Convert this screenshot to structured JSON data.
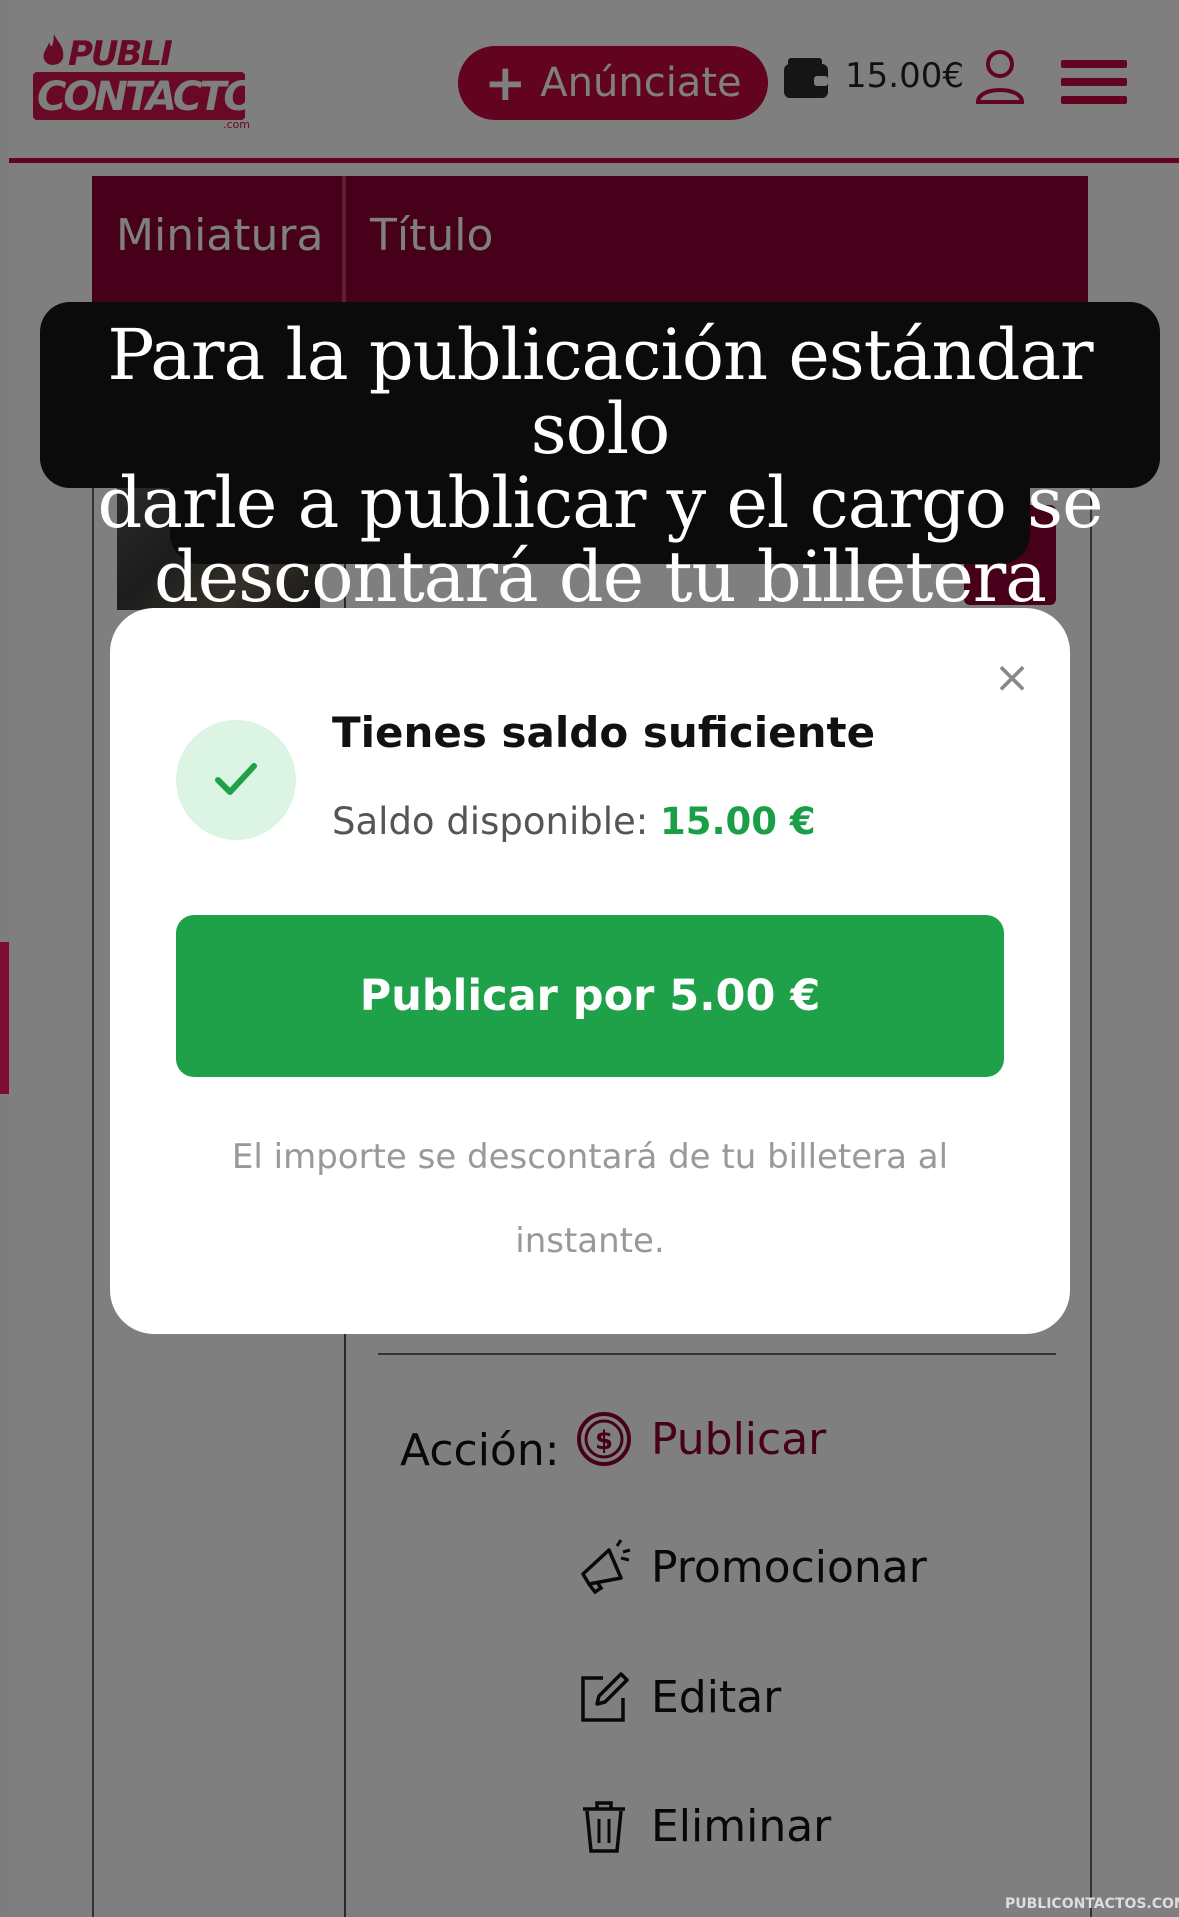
{
  "header": {
    "logo_top": "PUBLI",
    "logo_bottom": "CONTACTOS",
    "logo_suffix": ".com",
    "cta_label": "Anúnciate",
    "balance": "15.00€"
  },
  "table": {
    "col_thumbnail": "Miniatura",
    "col_title": "Título"
  },
  "actions": {
    "label": "Acción:",
    "publish": "Publicar",
    "promote": "Promocionar",
    "edit": "Editar",
    "delete": "Eliminar"
  },
  "caption": {
    "line1": "Para la publicación estándar solo",
    "line2": "darle a publicar y el cargo se",
    "line3": "descontará de tu billetera"
  },
  "modal": {
    "title": "Tienes saldo suficiente",
    "balance_label": "Saldo disponible:",
    "balance_value": "15.00 €",
    "publish_button": "Publicar por 5.00 €",
    "note_line1": "El importe se descontará de tu billetera al",
    "note_line2": "instante.",
    "close": "×"
  },
  "watermark": "PUBLICONTACTOS.COM",
  "colors": {
    "brand": "#c4063f",
    "table_header": "#8e0033",
    "success": "#1fa14a"
  }
}
